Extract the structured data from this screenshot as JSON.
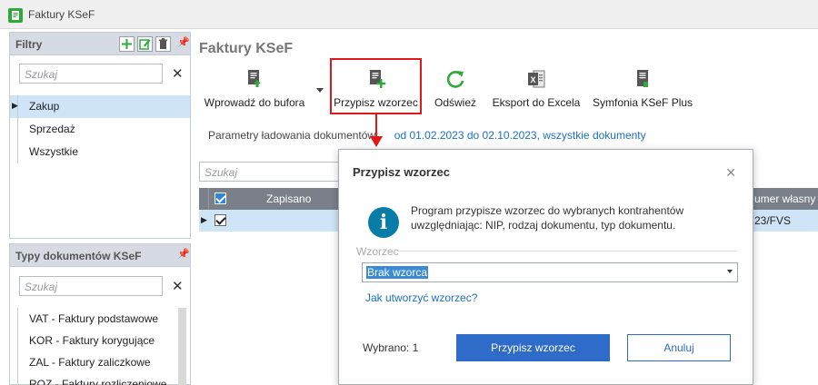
{
  "window": {
    "title": "Faktury KSeF"
  },
  "filters_panel": {
    "title": "Filtry",
    "search_placeholder": "Szukaj",
    "items": [
      {
        "label": "Zakup",
        "selected": true
      },
      {
        "label": "Sprzedaż",
        "selected": false
      },
      {
        "label": "Wszystkie",
        "selected": false
      }
    ]
  },
  "types_panel": {
    "title": "Typy dokumentów KSeF",
    "search_placeholder": "Szukaj",
    "items": [
      {
        "label": "VAT - Faktury podstawowe"
      },
      {
        "label": "KOR - Faktury korygujące"
      },
      {
        "label": "ZAL - Faktury zaliczkowe"
      },
      {
        "label": "ROZ - Faktury rozliczeniowe"
      }
    ]
  },
  "main": {
    "title": "Faktury KSeF",
    "toolbar": [
      {
        "label": "Wprowadź do bufora",
        "icon": "doc-upload-icon"
      },
      {
        "label": "Przypisz wzorzec",
        "icon": "doc-add-icon"
      },
      {
        "label": "Odśwież",
        "icon": "refresh-icon"
      },
      {
        "label": "Eksport do Excela",
        "icon": "excel-icon"
      },
      {
        "label": "Symfonia KSeF Plus",
        "icon": "doc-ksef-icon"
      }
    ],
    "params_label": "Parametry ładowania dokumentów:",
    "params_value": "od 01.02.2023 do 02.10.2023, wszystkie dokumenty",
    "grid": {
      "search_placeholder": "Szukaj",
      "columns": [
        "Zapisano",
        "umer własny"
      ],
      "row": {
        "own_number": "23/FVS"
      }
    }
  },
  "dialog": {
    "title": "Przypisz wzorzec",
    "message_line1": "Program przypisze wzorzec do wybranych kontrahentów",
    "message_line2": "uwzględniając: NIP, rodzaj dokumentu, typ dokumentu.",
    "field_label": "Wzorzec",
    "field_value": "Brak wzorca",
    "help_link": "Jak utworzyć wzorzec?",
    "selected_text": "Wybrano: 1",
    "ok_label": "Przypisz wzorzec",
    "cancel_label": "Anuluj"
  },
  "colors": {
    "accent": "#2f6bc8",
    "highlight": "#e01818",
    "selection": "#cfe4f7",
    "info": "#0a7ca8"
  }
}
